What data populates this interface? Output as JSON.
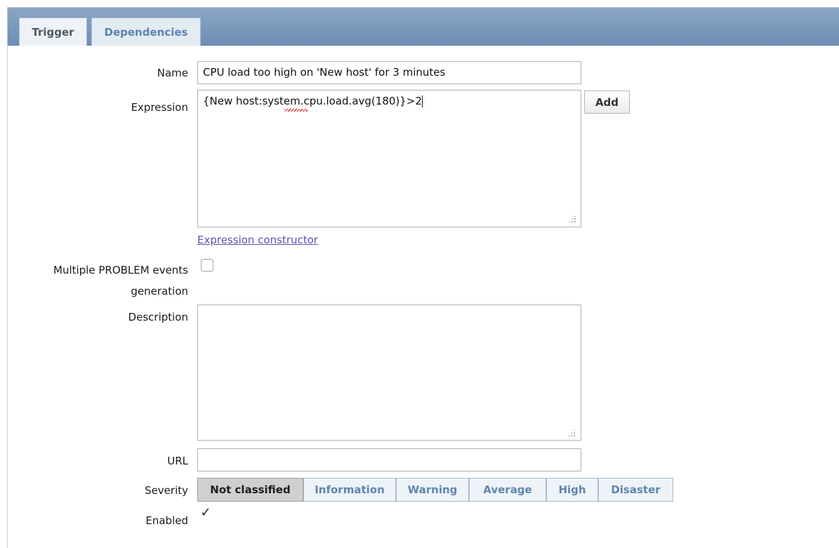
{
  "tabs": [
    {
      "label": "Trigger",
      "active": true
    },
    {
      "label": "Dependencies",
      "active": false
    }
  ],
  "form": {
    "name": {
      "label": "Name",
      "value": "CPU load too high on 'New host' for 3 minutes"
    },
    "expression": {
      "label": "Expression",
      "value": "{New host:system.cpu.load.avg(180)}>2",
      "add_button": "Add",
      "constructor_link": "Expression constructor"
    },
    "multiple_problem": {
      "label_line1": "Multiple PROBLEM events",
      "label_line2": "generation",
      "checked": false
    },
    "description": {
      "label": "Description",
      "value": ""
    },
    "url": {
      "label": "URL",
      "value": ""
    },
    "severity": {
      "label": "Severity",
      "options": [
        "Not classified",
        "Information",
        "Warning",
        "Average",
        "High",
        "Disaster"
      ],
      "selected": "Not classified"
    },
    "enabled": {
      "label": "Enabled",
      "checked": true,
      "check_glyph": "✓"
    }
  },
  "colors": {
    "tab_bar": "#7d9bbd",
    "link": "#5a53b3",
    "severity_text": "#5e86ad",
    "severity_selected_bg": "#d0d0d0"
  }
}
